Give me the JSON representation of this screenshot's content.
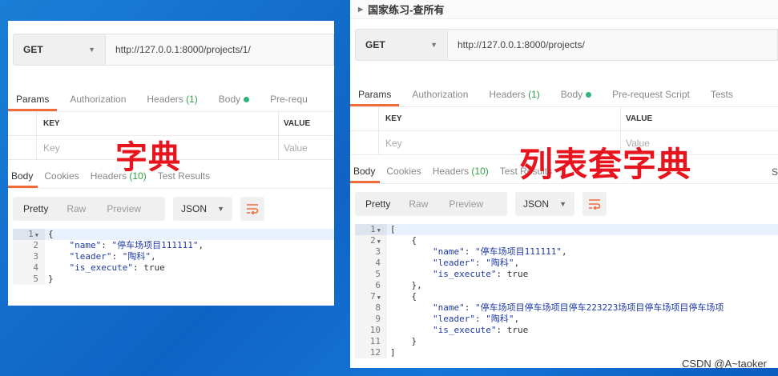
{
  "left": {
    "method": "GET",
    "url": "http://127.0.0.1:8000/projects/1/",
    "tabs": [
      {
        "label": "Params",
        "count": "",
        "active": true
      },
      {
        "label": "Authorization",
        "count": ""
      },
      {
        "label": "Headers",
        "count": "(1)"
      },
      {
        "label": "Body",
        "count": "",
        "dot": true
      },
      {
        "label": "Pre-requ",
        "count": ""
      }
    ],
    "kv": {
      "key_header": "KEY",
      "value_header": "VALUE",
      "key_placeholder": "Key",
      "value_placeholder": "Value"
    },
    "response_tabs": [
      {
        "label": "Body",
        "active": true
      },
      {
        "label": "Cookies"
      },
      {
        "label": "Headers",
        "count": "(10)"
      },
      {
        "label": "Test Results"
      }
    ],
    "view_modes": [
      "Pretty",
      "Raw",
      "Preview"
    ],
    "format": "JSON",
    "code": [
      {
        "n": "1",
        "fold": true,
        "tokens": [
          {
            "t": "{",
            "c": "jb"
          }
        ]
      },
      {
        "n": "2",
        "tokens": [
          {
            "t": "    ",
            "c": "jb"
          },
          {
            "t": "\"name\"",
            "c": "jk"
          },
          {
            "t": ": ",
            "c": "jb"
          },
          {
            "t": "\"停车场项目111111\"",
            "c": "js"
          },
          {
            "t": ",",
            "c": "jb"
          }
        ]
      },
      {
        "n": "3",
        "tokens": [
          {
            "t": "    ",
            "c": "jb"
          },
          {
            "t": "\"leader\"",
            "c": "jk"
          },
          {
            "t": ": ",
            "c": "jb"
          },
          {
            "t": "\"陶科\"",
            "c": "js"
          },
          {
            "t": ",",
            "c": "jb"
          }
        ]
      },
      {
        "n": "4",
        "tokens": [
          {
            "t": "    ",
            "c": "jb"
          },
          {
            "t": "\"is_execute\"",
            "c": "jk"
          },
          {
            "t": ": true",
            "c": "jb"
          }
        ]
      },
      {
        "n": "5",
        "tokens": [
          {
            "t": "}",
            "c": "jb"
          }
        ]
      }
    ],
    "overlay_label": "字典"
  },
  "right": {
    "collection_title": "国家练习-查所有",
    "method": "GET",
    "url": "http://127.0.0.1:8000/projects/",
    "tabs": [
      {
        "label": "Params",
        "active": true
      },
      {
        "label": "Authorization"
      },
      {
        "label": "Headers",
        "count": "(1)"
      },
      {
        "label": "Body",
        "dot": true
      },
      {
        "label": "Pre-request Script"
      },
      {
        "label": "Tests"
      }
    ],
    "kv": {
      "key_header": "KEY",
      "value_header": "VALUE",
      "key_placeholder": "Key",
      "value_placeholder": "Value"
    },
    "response_tabs": [
      {
        "label": "Body",
        "active": true
      },
      {
        "label": "Cookies"
      },
      {
        "label": "Headers",
        "count": "(10)"
      },
      {
        "label": "Test Results"
      }
    ],
    "s_fragment": "S",
    "view_modes": [
      "Pretty",
      "Raw",
      "Preview"
    ],
    "format": "JSON",
    "code": [
      {
        "n": "1",
        "fold": true,
        "tokens": [
          {
            "t": "[",
            "c": "jb"
          }
        ]
      },
      {
        "n": "2",
        "fold": true,
        "tokens": [
          {
            "t": "    {",
            "c": "jb"
          }
        ]
      },
      {
        "n": "3",
        "tokens": [
          {
            "t": "        ",
            "c": "jb"
          },
          {
            "t": "\"name\"",
            "c": "jk"
          },
          {
            "t": ": ",
            "c": "jb"
          },
          {
            "t": "\"停车场项目111111\"",
            "c": "js"
          },
          {
            "t": ",",
            "c": "jb"
          }
        ]
      },
      {
        "n": "4",
        "tokens": [
          {
            "t": "        ",
            "c": "jb"
          },
          {
            "t": "\"leader\"",
            "c": "jk"
          },
          {
            "t": ": ",
            "c": "jb"
          },
          {
            "t": "\"陶科\"",
            "c": "js"
          },
          {
            "t": ",",
            "c": "jb"
          }
        ]
      },
      {
        "n": "5",
        "tokens": [
          {
            "t": "        ",
            "c": "jb"
          },
          {
            "t": "\"is_execute\"",
            "c": "jk"
          },
          {
            "t": ": true",
            "c": "jb"
          }
        ]
      },
      {
        "n": "6",
        "tokens": [
          {
            "t": "    },",
            "c": "jb"
          }
        ]
      },
      {
        "n": "7",
        "fold": true,
        "tokens": [
          {
            "t": "    {",
            "c": "jb"
          }
        ]
      },
      {
        "n": "8",
        "tokens": [
          {
            "t": "        ",
            "c": "jb"
          },
          {
            "t": "\"name\"",
            "c": "jk"
          },
          {
            "t": ": ",
            "c": "jb"
          },
          {
            "t": "\"停车场项目停车场项目停车223223场项目停车场项目停车场项",
            "c": "js"
          }
        ]
      },
      {
        "n": "9",
        "tokens": [
          {
            "t": "        ",
            "c": "jb"
          },
          {
            "t": "\"leader\"",
            "c": "jk"
          },
          {
            "t": ": ",
            "c": "jb"
          },
          {
            "t": "\"陶科\"",
            "c": "js"
          },
          {
            "t": ",",
            "c": "jb"
          }
        ]
      },
      {
        "n": "10",
        "tokens": [
          {
            "t": "        ",
            "c": "jb"
          },
          {
            "t": "\"is_execute\"",
            "c": "jk"
          },
          {
            "t": ": true",
            "c": "jb"
          }
        ]
      },
      {
        "n": "11",
        "tokens": [
          {
            "t": "    }",
            "c": "jb"
          }
        ]
      },
      {
        "n": "12",
        "tokens": [
          {
            "t": "]",
            "c": "jb"
          }
        ]
      }
    ],
    "overlay_label": "列表套字典"
  },
  "watermark": "CSDN @A~taoker",
  "colors": {
    "accent": "#f26b3a",
    "count_green": "#2f9e44",
    "overlay_red": "#e8141d",
    "json_key": "#1f3aa8"
  }
}
